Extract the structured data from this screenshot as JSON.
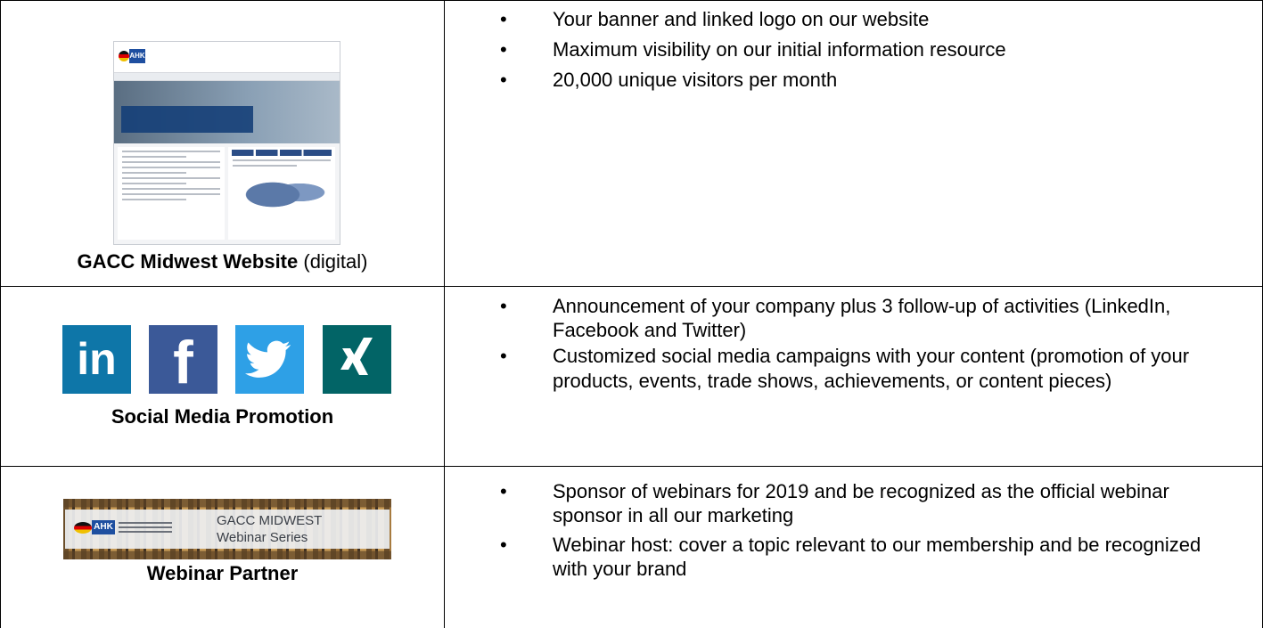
{
  "rows": [
    {
      "caption_bold": "GACC Midwest Website",
      "caption_rest": " (digital)",
      "bullets": [
        "Your banner and linked logo on our website",
        "Maximum visibility on our initial information resource",
        "20,000 unique visitors per month"
      ]
    },
    {
      "caption_bold": "Social Media Promotion",
      "icons": [
        "linkedin-icon",
        "facebook-icon",
        "twitter-icon",
        "xing-icon"
      ],
      "icon_glyphs": {
        "linkedin": "in",
        "facebook": "f"
      },
      "bullets": [
        "Announcement of your company plus 3 follow-up of activities (LinkedIn, Facebook and Twitter)",
        "Customized social media campaigns with your content (promotion of your products, events, trade shows, achievements, or content pieces)"
      ]
    },
    {
      "caption_bold": "Webinar Partner",
      "banner": {
        "logo": "AHK",
        "line1": "GACC MIDWEST",
        "line2": "Webinar Series"
      },
      "bullets": [
        "Sponsor of webinars for 2019 and be recognized as the official webinar sponsor in all our marketing",
        "Webinar host: cover a topic relevant to our membership and be recognized with your brand"
      ]
    }
  ],
  "website_thumbnail": {
    "logo": "AHK"
  },
  "colors": {
    "linkedin": "#0e76a8",
    "facebook": "#3b5998",
    "twitter": "#2ea0e6",
    "xing": "#026466"
  }
}
